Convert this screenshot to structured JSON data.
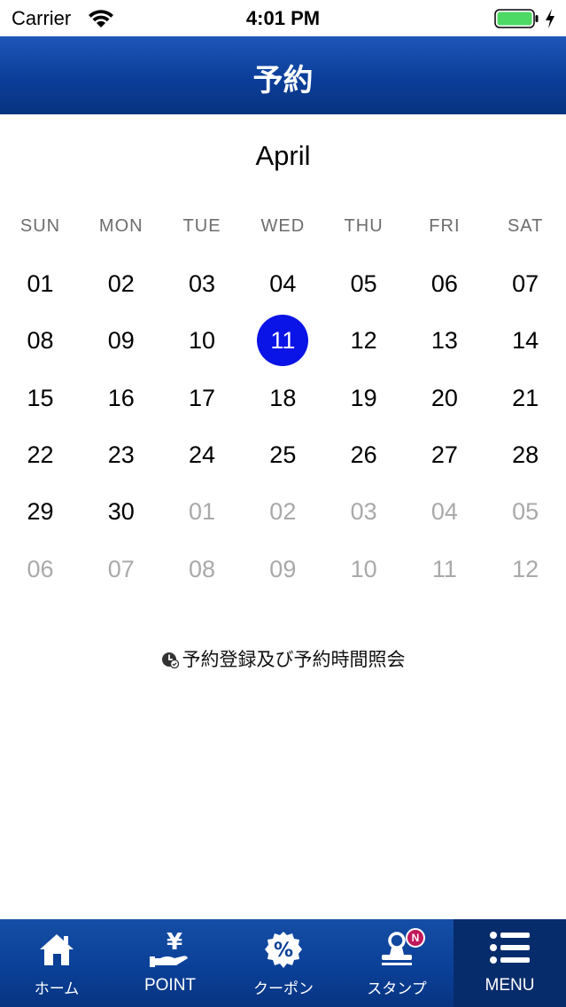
{
  "status_bar": {
    "carrier": "Carrier",
    "time": "4:01 PM"
  },
  "nav": {
    "title": "予約"
  },
  "calendar": {
    "month": "April",
    "weekdays": [
      "SUN",
      "MON",
      "TUE",
      "WED",
      "THU",
      "FRI",
      "SAT"
    ],
    "selected_day": "11",
    "selected_color": "#0b14e6",
    "weeks": [
      [
        {
          "d": "01",
          "cur": true
        },
        {
          "d": "02",
          "cur": true
        },
        {
          "d": "03",
          "cur": true
        },
        {
          "d": "04",
          "cur": true
        },
        {
          "d": "05",
          "cur": true
        },
        {
          "d": "06",
          "cur": true
        },
        {
          "d": "07",
          "cur": true
        }
      ],
      [
        {
          "d": "08",
          "cur": true
        },
        {
          "d": "09",
          "cur": true
        },
        {
          "d": "10",
          "cur": true
        },
        {
          "d": "11",
          "cur": true,
          "sel": true
        },
        {
          "d": "12",
          "cur": true
        },
        {
          "d": "13",
          "cur": true
        },
        {
          "d": "14",
          "cur": true
        }
      ],
      [
        {
          "d": "15",
          "cur": true
        },
        {
          "d": "16",
          "cur": true
        },
        {
          "d": "17",
          "cur": true
        },
        {
          "d": "18",
          "cur": true
        },
        {
          "d": "19",
          "cur": true
        },
        {
          "d": "20",
          "cur": true
        },
        {
          "d": "21",
          "cur": true
        }
      ],
      [
        {
          "d": "22",
          "cur": true
        },
        {
          "d": "23",
          "cur": true
        },
        {
          "d": "24",
          "cur": true
        },
        {
          "d": "25",
          "cur": true
        },
        {
          "d": "26",
          "cur": true
        },
        {
          "d": "27",
          "cur": true
        },
        {
          "d": "28",
          "cur": true
        }
      ],
      [
        {
          "d": "29",
          "cur": true
        },
        {
          "d": "30",
          "cur": true
        },
        {
          "d": "01",
          "cur": false
        },
        {
          "d": "02",
          "cur": false
        },
        {
          "d": "03",
          "cur": false
        },
        {
          "d": "04",
          "cur": false
        },
        {
          "d": "05",
          "cur": false
        }
      ],
      [
        {
          "d": "06",
          "cur": false
        },
        {
          "d": "07",
          "cur": false
        },
        {
          "d": "08",
          "cur": false
        },
        {
          "d": "09",
          "cur": false
        },
        {
          "d": "10",
          "cur": false
        },
        {
          "d": "11",
          "cur": false
        },
        {
          "d": "12",
          "cur": false
        }
      ]
    ]
  },
  "reserve_link": {
    "label": "予約登録及び予約時間照会",
    "icon": "clock-icon"
  },
  "tab_bar": {
    "tabs": [
      {
        "label": "ホーム",
        "icon": "home-icon"
      },
      {
        "label": "POINT",
        "icon": "yen-hand-icon"
      },
      {
        "label": "クーポン",
        "icon": "percent-coupon-icon"
      },
      {
        "label": "スタンプ",
        "icon": "stamp-icon",
        "badge": "N"
      },
      {
        "label": "MENU",
        "icon": "menu-list-icon",
        "active": true
      }
    ]
  },
  "colors": {
    "nav_blue": "#0b3e99",
    "tab_blue": "#0a3f96",
    "badge": "#c2185b",
    "battery": "#4cd964"
  }
}
